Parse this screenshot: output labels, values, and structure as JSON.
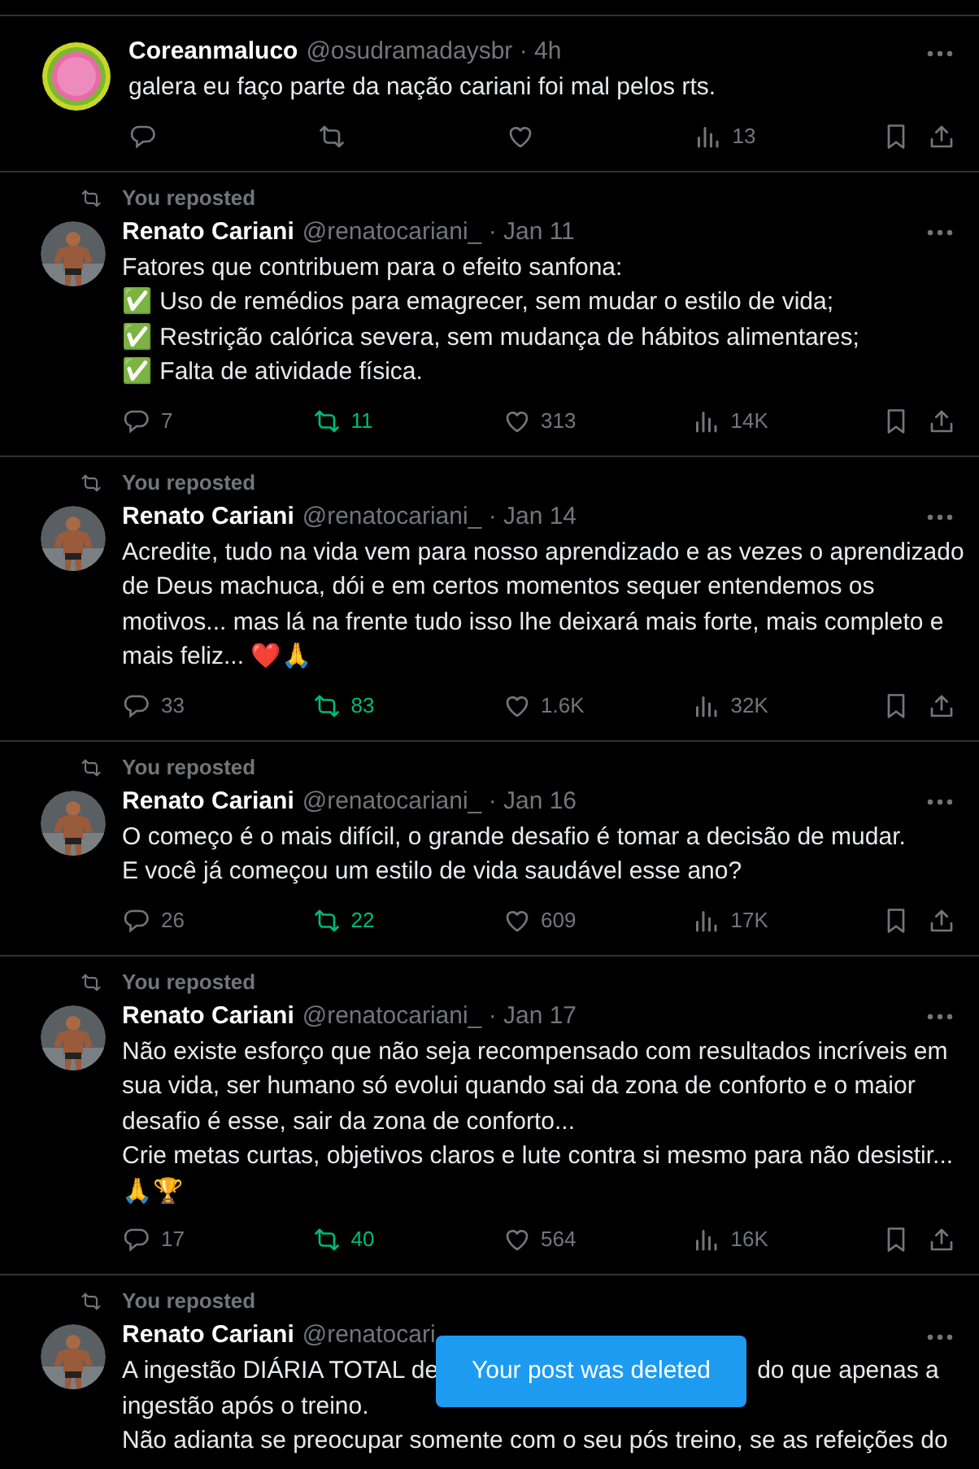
{
  "posts": [
    {
      "author": "Coreanmaluco",
      "meta": "@osudramadaysbr · 4h",
      "kind": "logo_avatar",
      "body": [
        "galera eu faço parte da nação cariani foi mal pelos rts."
      ],
      "actions": [
        {
          "kind": "reply",
          "active": false
        },
        {
          "kind": "repost",
          "active": false
        },
        {
          "kind": "like",
          "active": false
        },
        {
          "kind": "views",
          "count": "13",
          "active": false
        },
        {
          "kind": "bookmark",
          "active": false
        },
        {
          "kind": "share",
          "active": false
        }
      ]
    },
    {
      "repost_label": "You reposted",
      "author": "Renato Cariani",
      "meta": "@renatocariani_ · Jan 11",
      "kind": "photo_avatar",
      "body": [
        "Fatores que contribuem para o efeito sanfona:",
        "✅ Uso de remédios para emagrecer, sem mudar o estilo de vida;",
        "✅ Restrição calórica severa, sem mudança de hábitos alimentares;",
        "✅ Falta de atividade física."
      ],
      "actions": [
        {
          "kind": "reply",
          "count": "7",
          "active": false
        },
        {
          "kind": "repost",
          "count": "11",
          "active": true
        },
        {
          "kind": "like",
          "count": "313",
          "active": false
        },
        {
          "kind": "views",
          "count": "14K",
          "active": false
        },
        {
          "kind": "bookmark",
          "active": false
        },
        {
          "kind": "share",
          "active": false
        }
      ]
    },
    {
      "repost_label": "You reposted",
      "author": "Renato Cariani",
      "meta": "@renatocariani_ · Jan 14",
      "kind": "photo_avatar",
      "body": [
        "Acredite, tudo na vida vem para nosso aprendizado e as vezes o aprendizado",
        "de Deus machuca, dói e em certos momentos sequer entendemos os",
        "motivos... mas lá na frente tudo isso lhe deixará mais forte, mais completo e",
        "mais feliz... ❤️🙏"
      ],
      "actions": [
        {
          "kind": "reply",
          "count": "33",
          "active": false
        },
        {
          "kind": "repost",
          "count": "83",
          "active": true
        },
        {
          "kind": "like",
          "count": "1.6K",
          "active": false
        },
        {
          "kind": "views",
          "count": "32K",
          "active": false
        },
        {
          "kind": "bookmark",
          "active": false
        },
        {
          "kind": "share",
          "active": false
        }
      ]
    },
    {
      "repost_label": "You reposted",
      "author": "Renato Cariani",
      "meta": "@renatocariani_ · Jan 16",
      "kind": "photo_avatar",
      "body": [
        "O começo é o mais difícil, o grande desafio é tomar a decisão de mudar.",
        "E você já começou um estilo de vida saudável esse ano?"
      ],
      "actions": [
        {
          "kind": "reply",
          "count": "26",
          "active": false
        },
        {
          "kind": "repost",
          "count": "22",
          "active": true
        },
        {
          "kind": "like",
          "count": "609",
          "active": false
        },
        {
          "kind": "views",
          "count": "17K",
          "active": false
        },
        {
          "kind": "bookmark",
          "active": false
        },
        {
          "kind": "share",
          "active": false
        }
      ]
    },
    {
      "repost_label": "You reposted",
      "author": "Renato Cariani",
      "meta": "@renatocariani_ · Jan 17",
      "kind": "photo_avatar",
      "body": [
        "Não existe esforço que não seja recompensado com resultados incríveis em",
        "sua vida, ser humano só evolui quando sai da zona de conforto e o maior",
        "desafio é esse, sair da zona de conforto...",
        "Crie metas curtas, objetivos claros e lute contra si mesmo para não desistir...",
        "🙏🏆"
      ],
      "actions": [
        {
          "kind": "reply",
          "count": "17",
          "active": false
        },
        {
          "kind": "repost",
          "count": "40",
          "active": true
        },
        {
          "kind": "like",
          "count": "564",
          "active": false
        },
        {
          "kind": "views",
          "count": "16K",
          "active": false
        },
        {
          "kind": "bookmark",
          "active": false
        },
        {
          "kind": "share",
          "active": false
        }
      ]
    },
    {
      "repost_label": "You reposted",
      "author": "Renato Cariani",
      "meta": "@renatocari",
      "kind": "photo_avatar",
      "body": [
        [
          "A ingestão DIÁRIA TOTAL de",
          "do que apenas a"
        ],
        "ingestão após o treino.",
        "Não adianta se preocupar somente com o seu pós treino, se as refeições do"
      ]
    }
  ],
  "toast": "Your post was deleted"
}
